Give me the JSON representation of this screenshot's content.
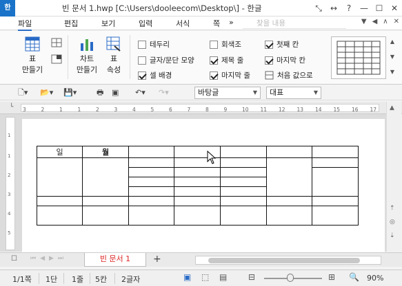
{
  "titlebar": {
    "app_logo": "한",
    "title": "빈 문서 1.hwp [C:\\Users\\dooleecom\\Desktop\\] - 한글",
    "icons": [
      "restore-small-icon",
      "resize-icon",
      "help-icon",
      "minimize-icon",
      "maximize-icon",
      "close-icon"
    ]
  },
  "menubar": {
    "items": [
      "파일",
      "편집",
      "보기",
      "입력",
      "서식",
      "쪽"
    ],
    "more": "»",
    "search_placeholder": "찾을 내용"
  },
  "ribbon": {
    "table_btn": {
      "line1": "표",
      "line2": "만들기"
    },
    "chart_btn": {
      "line1": "차트",
      "line2": "만들기"
    },
    "props_btn": {
      "line1": "표",
      "line2": "속성"
    },
    "options": [
      {
        "label": "테두리",
        "checked": false
      },
      {
        "label": "글자/문단 모양",
        "checked": false
      },
      {
        "label": "셀 배경",
        "checked": true
      },
      {
        "label": "회색조",
        "checked": false
      },
      {
        "label": "제목 줄",
        "checked": true
      },
      {
        "label": "마지막 줄",
        "checked": true
      },
      {
        "label": "첫째 칸",
        "checked": true
      },
      {
        "label": "마지막 칸",
        "checked": true
      }
    ],
    "reset_label": "처음 값으로"
  },
  "toolbar": {
    "style_combo": "바탕글",
    "style_combo2": "대표"
  },
  "ruler": {
    "numbers": [
      "3",
      "2",
      "1",
      "1",
      "2",
      "3",
      "4",
      "5",
      "6",
      "7",
      "8",
      "9",
      "10",
      "11",
      "12",
      "13",
      "14",
      "15",
      "16",
      "17"
    ]
  },
  "table": {
    "cell_1": "일",
    "cell_2": "월"
  },
  "tabs": {
    "doc_tab": "빈 문서 1",
    "add": "+"
  },
  "statusbar": {
    "page": "1/1쪽",
    "section": "1단",
    "line": "1줄",
    "col": "5칸",
    "chars": "2글자",
    "zoom": "90%"
  },
  "colors": {
    "accent": "#2a6bc6",
    "active_tab_text": "#d22222",
    "app_logo_bg": "#1a73c8"
  }
}
